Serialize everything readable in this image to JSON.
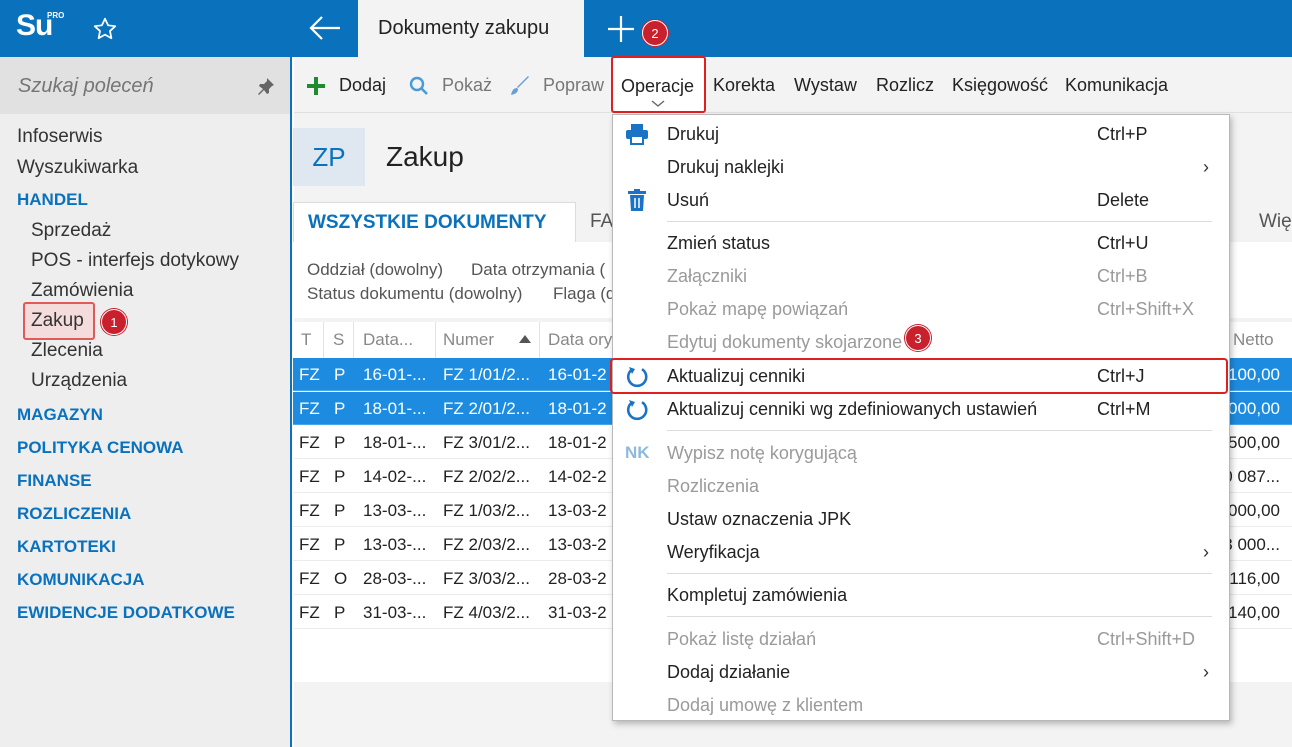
{
  "app": {
    "logo": "Su",
    "logo_sup": "PRO",
    "active_tab": "Dokumenty zakupu"
  },
  "sidebar": {
    "search_placeholder": "Szukaj poleceń",
    "items": [
      {
        "label": "Infoserwis"
      },
      {
        "label": "Wyszukiwarka"
      },
      {
        "label": "HANDEL"
      },
      {
        "label": "Sprzedaż"
      },
      {
        "label": "POS - interfejs dotykowy"
      },
      {
        "label": "Zamówienia"
      },
      {
        "label": "Zakup"
      },
      {
        "label": "Zlecenia"
      },
      {
        "label": "Urządzenia"
      },
      {
        "label": "MAGAZYN"
      },
      {
        "label": "POLITYKA CENOWA"
      },
      {
        "label": "FINANSE"
      },
      {
        "label": "ROZLICZENIA"
      },
      {
        "label": "KARTOTEKI"
      },
      {
        "label": "KOMUNIKACJA"
      },
      {
        "label": "EWIDENCJE DODATKOWE"
      }
    ]
  },
  "badges": {
    "b1": "1",
    "b2": "2",
    "b3": "3"
  },
  "toolbar": {
    "dodaj": "Dodaj",
    "pokaz": "Pokaż",
    "popraw": "Popraw",
    "operacje": "Operacje",
    "korekta": "Korekta",
    "wystaw": "Wystaw",
    "rozlicz": "Rozlicz",
    "ksiegowosc": "Księgowość",
    "komunikacja": "Komunikacja"
  },
  "header": {
    "code": "ZP",
    "title": "Zakup"
  },
  "tabs": {
    "all": "WSZYSTKIE DOKUMENTY",
    "fa": "FA",
    "more": "Wię"
  },
  "filters": {
    "oddzial": "Oddział (dowolny)",
    "data_otrz": "Data otrzymania (",
    "status": "Status dokumentu (dowolny)",
    "flaga": "Flaga (d"
  },
  "table": {
    "headers": {
      "t": "T",
      "s": "S",
      "data": "Data...",
      "numer": "Numer",
      "data_ory": "Data ory",
      "netto": "Netto"
    },
    "rows": [
      {
        "t": "FZ",
        "s": "P",
        "data": "16-01-...",
        "numer": "FZ 1/01/2...",
        "data_ory": "16-01-2",
        "netto": "100,00"
      },
      {
        "t": "FZ",
        "s": "P",
        "data": "18-01-...",
        "numer": "FZ 2/01/2...",
        "data_ory": "18-01-2",
        "netto": "000,00"
      },
      {
        "t": "FZ",
        "s": "P",
        "data": "18-01-...",
        "numer": "FZ 3/01/2...",
        "data_ory": "18-01-2",
        "netto": "500,00"
      },
      {
        "t": "FZ",
        "s": "P",
        "data": "14-02-...",
        "numer": "FZ 2/02/2...",
        "data_ory": "14-02-2",
        "netto": "0 087..."
      },
      {
        "t": "FZ",
        "s": "P",
        "data": "13-03-...",
        "numer": "FZ 1/03/2...",
        "data_ory": "13-03-2",
        "netto": "000,00"
      },
      {
        "t": "FZ",
        "s": "P",
        "data": "13-03-...",
        "numer": "FZ 2/03/2...",
        "data_ory": "13-03-2",
        "netto": "3 000..."
      },
      {
        "t": "FZ",
        "s": "O",
        "data": "28-03-...",
        "numer": "FZ 3/03/2...",
        "data_ory": "28-03-2",
        "netto": "116,00"
      },
      {
        "t": "FZ",
        "s": "P",
        "data": "31-03-...",
        "numer": "FZ 4/03/2...",
        "data_ory": "31-03-2",
        "netto": "140,00"
      }
    ]
  },
  "menu": {
    "items": [
      {
        "label": "Drukuj",
        "shortcut": "Ctrl+P"
      },
      {
        "label": "Drukuj naklejki",
        "shortcut": ""
      },
      {
        "label": "Usuń",
        "shortcut": "Delete"
      },
      {
        "label": "Zmień status",
        "shortcut": "Ctrl+U"
      },
      {
        "label": "Załączniki",
        "shortcut": "Ctrl+B"
      },
      {
        "label": "Pokaż mapę powiązań",
        "shortcut": "Ctrl+Shift+X"
      },
      {
        "label": "Edytuj dokumenty skojarzone",
        "shortcut": ""
      },
      {
        "label": "Aktualizuj cenniki",
        "shortcut": "Ctrl+J"
      },
      {
        "label": "Aktualizuj cenniki wg zdefiniowanych ustawień",
        "shortcut": "Ctrl+M"
      },
      {
        "label": "Wypisz notę korygującą",
        "shortcut": ""
      },
      {
        "label": "Rozliczenia",
        "shortcut": ""
      },
      {
        "label": "Ustaw oznaczenia JPK",
        "shortcut": ""
      },
      {
        "label": "Weryfikacja",
        "shortcut": ""
      },
      {
        "label": "Kompletuj zamówienia",
        "shortcut": ""
      },
      {
        "label": "Pokaż listę działań",
        "shortcut": "Ctrl+Shift+D"
      },
      {
        "label": "Dodaj działanie",
        "shortcut": ""
      },
      {
        "label": "Dodaj umowę z klientem",
        "shortcut": ""
      }
    ],
    "nk_icon": "NK",
    "submenu_arrow": "›"
  },
  "colors": {
    "accent": "#0a72bd",
    "selected_row": "#1d8ce0",
    "highlight": "#e02020"
  }
}
